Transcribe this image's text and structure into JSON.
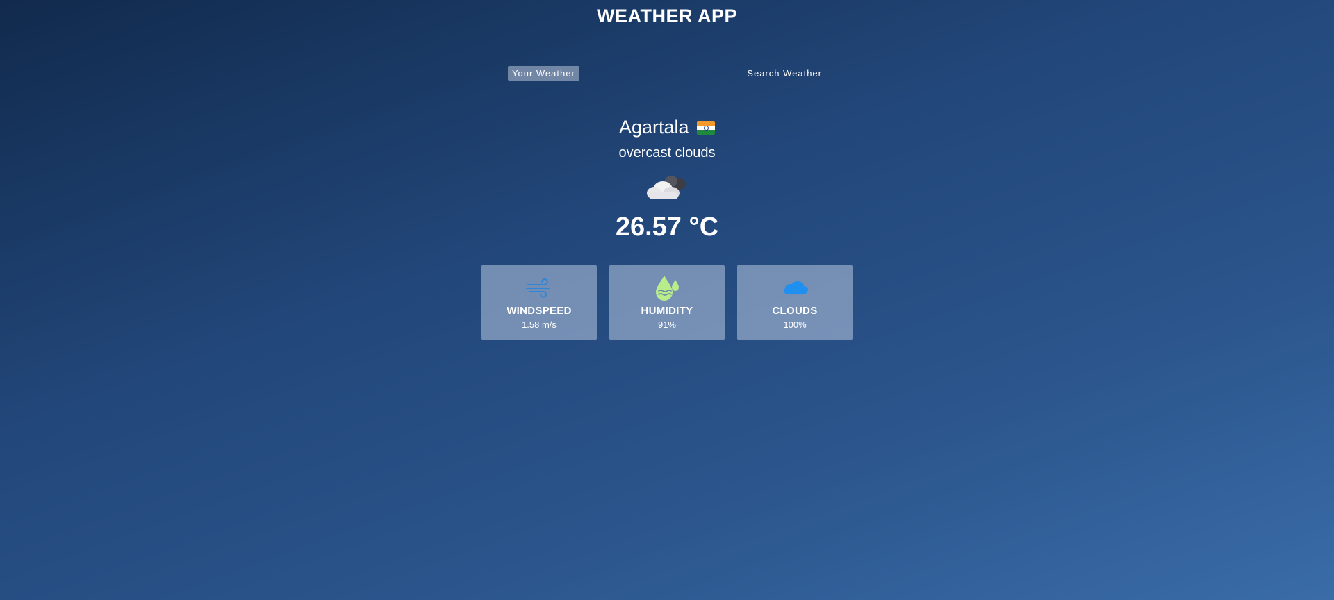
{
  "app": {
    "title": "WEATHER APP"
  },
  "tabs": {
    "your_weather": "Your Weather",
    "search_weather": "Search Weather"
  },
  "weather": {
    "city": "Agartala",
    "country_flag": "india-flag-icon",
    "description": "overcast clouds",
    "condition_icon": "cloud-icon",
    "temperature": "26.57 °C"
  },
  "cards": [
    {
      "title": "WINDSPEED",
      "value": "1.58 m/s",
      "icon": "wind-icon"
    },
    {
      "title": "HUMIDITY",
      "value": "91%",
      "icon": "humidity-icon"
    },
    {
      "title": "CLOUDS",
      "value": "100%",
      "icon": "clouds-icon"
    }
  ],
  "colors": {
    "background_start": "#112a4d",
    "background_end": "#3a6ca8",
    "card_background": "#8a9ebf",
    "wind_icon": "#2f86d8",
    "humidity_icon": "#b9ec8a",
    "clouds_icon": "#1f8ff0"
  }
}
